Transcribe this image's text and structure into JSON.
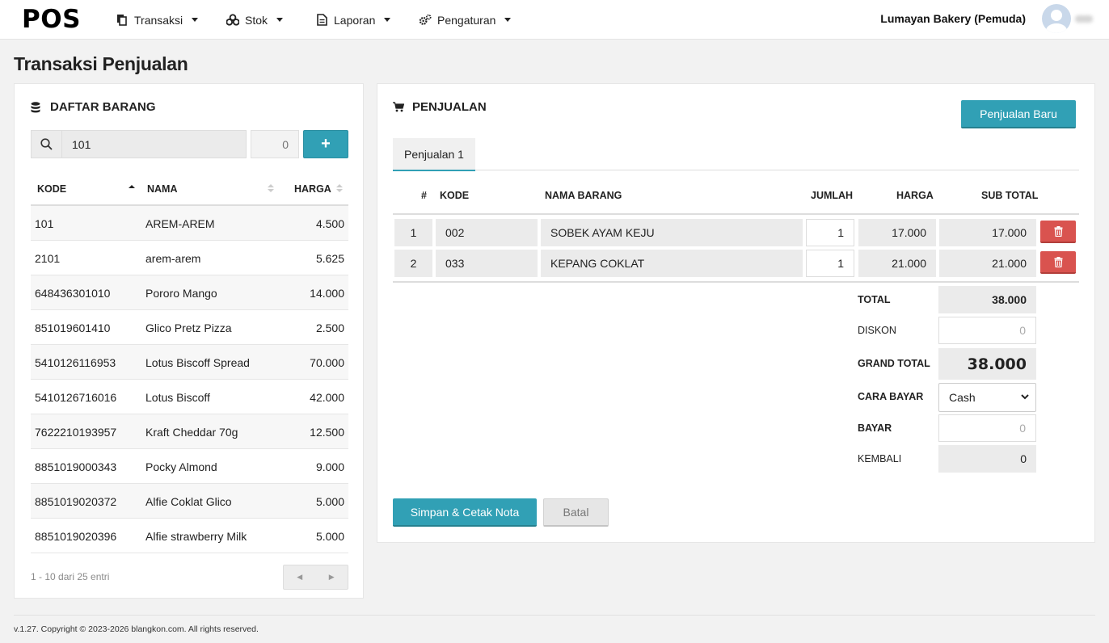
{
  "navbar": {
    "brand": "POS",
    "menus": [
      {
        "label": "Transaksi",
        "icon": "copy-icon"
      },
      {
        "label": "Stok",
        "icon": "cubes-icon"
      },
      {
        "label": "Laporan",
        "icon": "file-text-icon"
      },
      {
        "label": "Pengaturan",
        "icon": "cogs-icon"
      }
    ],
    "store_name": "Lumayan Bakery (Pemuda)"
  },
  "page_title": "Transaksi Penjualan",
  "left_panel": {
    "title": "DAFTAR BARANG",
    "search_value": "101",
    "qty_placeholder": "0",
    "add_label": "+",
    "columns": [
      "KODE",
      "NAMA",
      "HARGA"
    ],
    "rows": [
      {
        "kode": "101",
        "nama": "AREM-AREM",
        "harga": "4.500"
      },
      {
        "kode": "2101",
        "nama": "arem-arem",
        "harga": "5.625"
      },
      {
        "kode": "648436301010",
        "nama": "Pororo Mango",
        "harga": "14.000"
      },
      {
        "kode": "851019601410",
        "nama": "Glico Pretz Pizza",
        "harga": "2.500"
      },
      {
        "kode": "5410126116953",
        "nama": "Lotus Biscoff Spread",
        "harga": "70.000"
      },
      {
        "kode": "5410126716016",
        "nama": "Lotus Biscoff",
        "harga": "42.000"
      },
      {
        "kode": "7622210193957",
        "nama": "Kraft Cheddar 70g",
        "harga": "12.500"
      },
      {
        "kode": "8851019000343",
        "nama": "Pocky Almond",
        "harga": "9.000"
      },
      {
        "kode": "8851019020372",
        "nama": "Alfie Coklat Glico",
        "harga": "5.000"
      },
      {
        "kode": "8851019020396",
        "nama": "Alfie strawberry Milk",
        "harga": "5.000"
      }
    ],
    "info": "1 - 10 dari 25 entri"
  },
  "right_panel": {
    "title": "PENJUALAN",
    "new_button": "Penjualan Baru",
    "tab": "Penjualan 1",
    "columns": [
      "#",
      "KODE",
      "NAMA BARANG",
      "JUMLAH",
      "HARGA",
      "SUB TOTAL"
    ],
    "rows": [
      {
        "no": "1",
        "kode": "002",
        "nama": "SOBEK AYAM KEJU",
        "jumlah": "1",
        "harga": "17.000",
        "subtotal": "17.000"
      },
      {
        "no": "2",
        "kode": "033",
        "nama": "KEPANG COKLAT",
        "jumlah": "1",
        "harga": "21.000",
        "subtotal": "21.000"
      }
    ],
    "summary": {
      "total_label": "TOTAL",
      "total": "38.000",
      "diskon_label": "DISKON",
      "diskon_placeholder": "0",
      "grand_label": "GRAND TOTAL",
      "grand_total": "38.000",
      "cara_label": "CARA BAYAR",
      "cara_value": "Cash",
      "bayar_label": "BAYAR",
      "bayar_placeholder": "0",
      "kembali_label": "KEMBALI",
      "kembali": "0"
    },
    "save_button": "Simpan & Cetak Nota",
    "cancel_button": "Batal"
  },
  "footer": "v.1.27. Copyright © 2023-2026 blangkon.com. All rights reserved.",
  "colors": {
    "accent": "#31a0b5",
    "danger": "#d9534f"
  }
}
